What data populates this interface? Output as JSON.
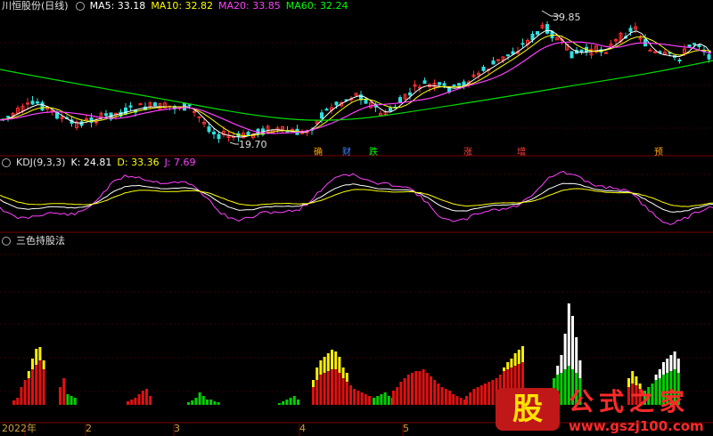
{
  "main_legend": {
    "title": "川恒股份(日线)",
    "ma5": "MA5: 33.18",
    "ma10": "MA10: 32.82",
    "ma20": "MA20: 33.85",
    "ma60": "MA60: 32.24",
    "colors": {
      "ma5": "#ffffff",
      "ma10": "#ffff00",
      "ma20": "#ff40ff",
      "ma60": "#00ff00"
    }
  },
  "main_panel": {
    "high_label": "39.85",
    "low_label": "19.70",
    "signals": [
      "确",
      "财",
      "跌",
      "涨",
      "增",
      "预"
    ],
    "signal_colors": [
      "#ffa500",
      "#4080ff",
      "#00ff00",
      "#ff4040",
      "#ff4040",
      "#ffa500"
    ]
  },
  "kdj_legend": {
    "title": "KDJ(9,3,3)",
    "k": "K: 24.81",
    "d": "D: 33.36",
    "j": "J: 7.69",
    "colors": {
      "k": "#ffffff",
      "d": "#ffff00",
      "j": "#ff40ff"
    }
  },
  "third_legend": {
    "title": "三色持股法"
  },
  "x_axis": {
    "labels": [
      "2022年",
      "2",
      "3",
      "4",
      "5"
    ]
  },
  "watermark": {
    "badge": "股",
    "title": "公式之家",
    "url": "www.gszj100.com"
  },
  "chart_data": [
    {
      "type": "candlestick",
      "panel": "price",
      "series": [
        {
          "name": "MA5"
        },
        {
          "name": "MA10"
        },
        {
          "name": "MA20"
        },
        {
          "name": "MA60"
        }
      ],
      "annotations": [
        {
          "text": "39.85",
          "kind": "high"
        },
        {
          "text": "19.70",
          "kind": "low"
        }
      ]
    },
    {
      "type": "line",
      "panel": "KDJ(9,3,3)",
      "series": [
        {
          "name": "K",
          "last": 24.81
        },
        {
          "name": "D",
          "last": 33.36
        },
        {
          "name": "J",
          "last": 7.69
        }
      ]
    },
    {
      "type": "bar",
      "panel": "三色持股法",
      "colors": [
        "#e01010",
        "#ffff00",
        "#00e000",
        "#ffffff"
      ]
    }
  ]
}
